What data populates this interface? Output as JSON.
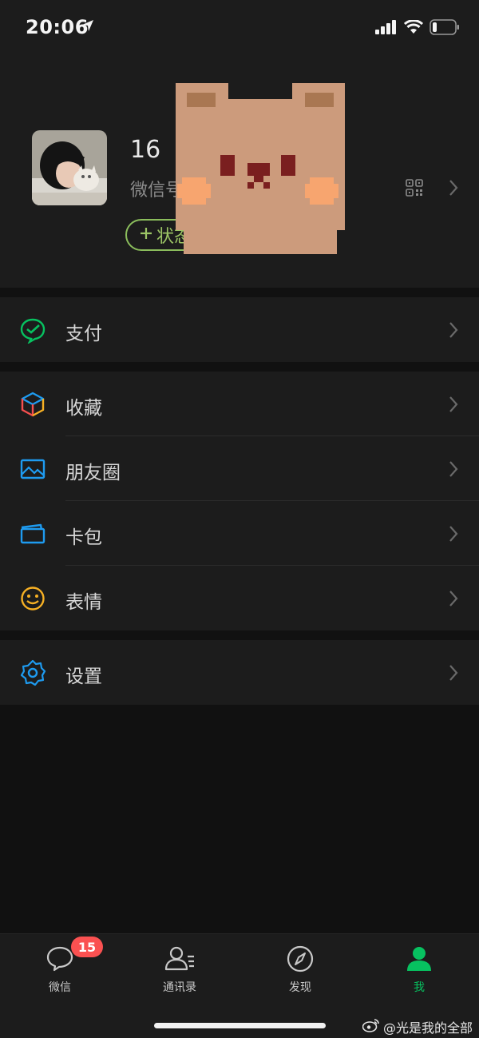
{
  "status_bar": {
    "time": "20:06"
  },
  "profile": {
    "nickname": "16",
    "wechat_id_label": "微信号",
    "status_button_label": "状态"
  },
  "menu": {
    "pay": "支付",
    "favorites": "收藏",
    "moments": "朋友圈",
    "cards": "卡包",
    "stickers": "表情",
    "settings": "设置"
  },
  "tabbar": {
    "chats": "微信",
    "contacts": "通讯录",
    "discover": "发现",
    "me": "我",
    "chats_badge": "15"
  },
  "watermark": "@光是我的全部",
  "colors": {
    "accent": "#07c160",
    "badge": "#fa5151",
    "status_green": "#9cc565",
    "background": "#111111",
    "card": "#1c1c1c"
  }
}
